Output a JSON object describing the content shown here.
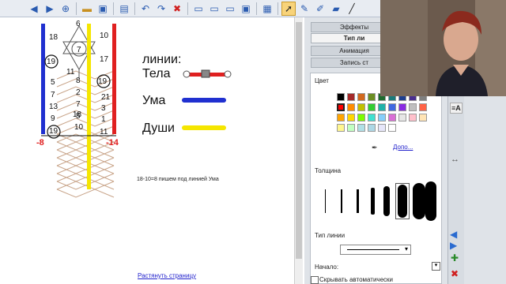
{
  "toolbar": {
    "icons": [
      "back-arrow",
      "forward-arrow",
      "add-page",
      "open-folder",
      "save",
      "paste",
      "undo",
      "redo",
      "delete",
      "screen-shade",
      "display",
      "show-all",
      "table",
      "select",
      "pen",
      "creative-pen",
      "eraser"
    ]
  },
  "canvas": {
    "diagram_numbers": [
      "6",
      "18",
      "10",
      "7",
      "19",
      "17",
      "11",
      "8",
      "2",
      "19",
      "5",
      "7",
      "21",
      "7",
      "3",
      "13",
      "5",
      "9",
      "18",
      "1",
      "19",
      "10",
      "11"
    ],
    "left_total": "-8",
    "right_total": "-14",
    "lines_title": "линии:",
    "body_label": "Тела",
    "mind_label": "Ума",
    "soul_label": "Души",
    "note": "18-10=8 пишем под линией Ума",
    "extend_page_link": "Растянуть страницу"
  },
  "panel": {
    "tabs": [
      "Эффекты",
      "Тип ли",
      "Анимация",
      "Запись ст"
    ],
    "color_section": "Цвет",
    "more_colors_link": "Допо...",
    "thickness_section": "Толщина",
    "line_type_section": "Тип линии",
    "start_label": "Начало:",
    "autohide_label": "Скрывать автоматически"
  },
  "colors": {
    "mind_line": "#2030d0",
    "soul_line": "#f5e600",
    "body_line": "#e02020",
    "negative_total": "#e02020",
    "swatches": [
      "#000000",
      "#a52a2a",
      "#d2691e",
      "#6b8e23",
      "#1f6b2f",
      "#1b7b7b",
      "#1f3f8f",
      "#4b2f8f",
      "#7f7f7f",
      "#ff0000",
      "#ff8c00",
      "#c0c000",
      "#32cd32",
      "#20b2aa",
      "#4169e1",
      "#8a2be2",
      "#bfbfbf",
      "#ff6347",
      "#ffa500",
      "#ffd700",
      "#7cfc00",
      "#40e0d0",
      "#87cefa",
      "#da70d6",
      "#e6e6e6",
      "#ffc0cb",
      "#ffe4b5",
      "#fff68f",
      "#c1ffc1",
      "#b0e0e6",
      "#add8e6",
      "#e6e6fa",
      "#ffffff"
    ]
  }
}
